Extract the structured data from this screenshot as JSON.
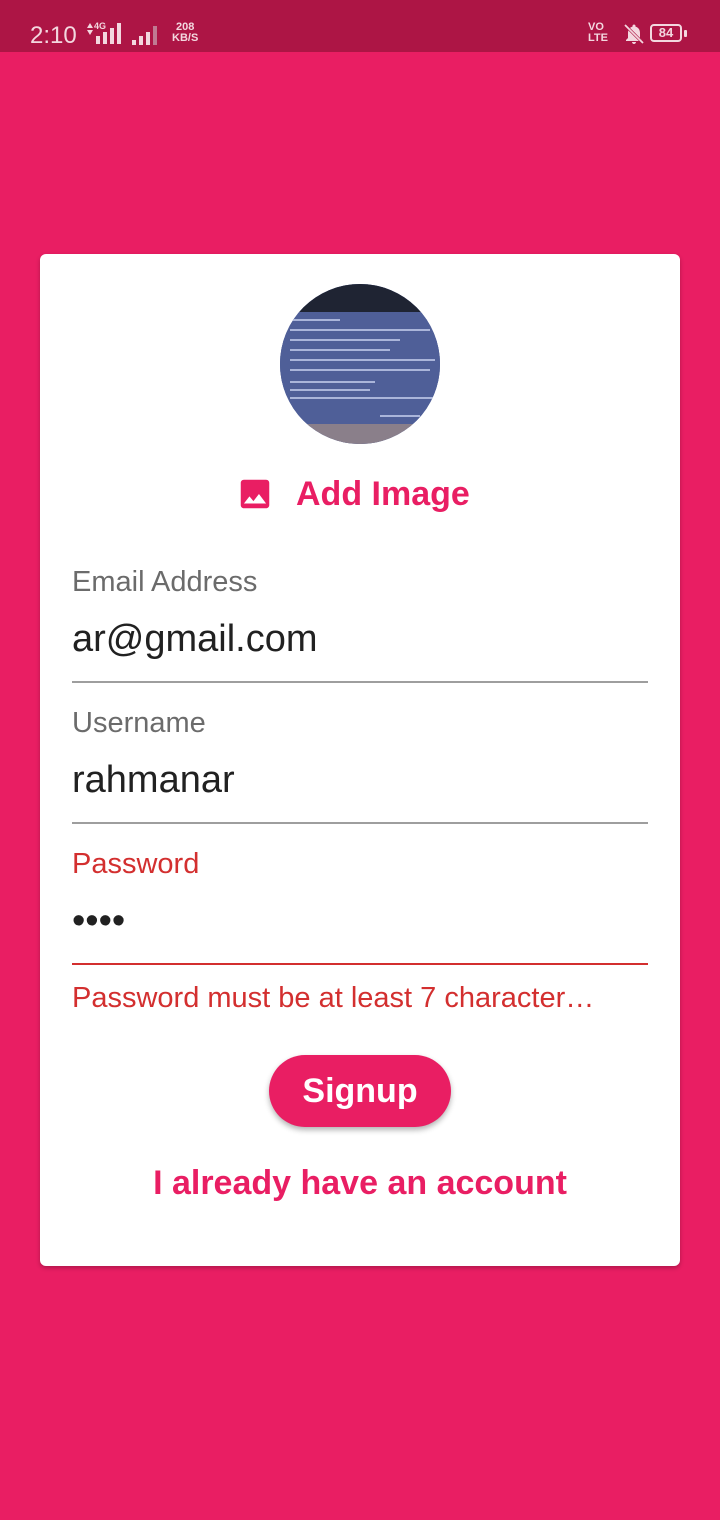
{
  "status_bar": {
    "time": "2:10",
    "network_type": "4G",
    "speed_value": "208",
    "speed_unit": "KB/S",
    "volte_top": "VO",
    "volte_bottom": "LTE",
    "battery": "84"
  },
  "card": {
    "add_image_label": "Add Image",
    "email": {
      "label": "Email Address",
      "value": "ar@gmail.com"
    },
    "username": {
      "label": "Username",
      "value": "rahmanar"
    },
    "password": {
      "label": "Password",
      "value": "••••",
      "error": "Password must be at least 7 character…"
    },
    "signup_label": "Signup",
    "login_link_label": "I already have an account"
  },
  "colors": {
    "accent": "#e91e63",
    "status_bar": "#ad1545",
    "error": "#d32f2f"
  }
}
